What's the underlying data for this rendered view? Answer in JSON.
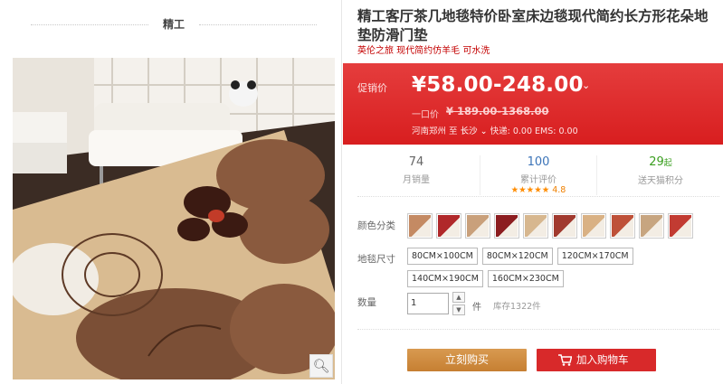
{
  "gallery": {
    "tab_label": "精工",
    "zoom_icon": "magnifier-icon"
  },
  "product": {
    "title": "精工客厅茶几地毯特价卧室床边毯现代简约长方形花朵地垫防滑门垫",
    "subtitle": "英伦之旅 现代简约仿羊毛 可水洗"
  },
  "price": {
    "promo_label": "促销价",
    "value": "¥58.00-248.00",
    "original_label": "一口价",
    "original_value": "¥ 189.00-1368.00",
    "ship_from": "河南郑州",
    "to_word": "至",
    "ship_to": "长沙",
    "shipping": "快递: 0.00  EMS: 0.00"
  },
  "stats": {
    "monthly_sales": {
      "value": "74",
      "label": "月销量"
    },
    "reviews": {
      "value": "100",
      "label": "累计评价",
      "stars": "★★★★★",
      "score": "4.8"
    },
    "points": {
      "value": "29",
      "unit": "起",
      "label": "送天猫积分"
    }
  },
  "options": {
    "color_label": "颜色分类",
    "swatch_colors": [
      "#c48a63",
      "#b0282a",
      "#c9a07b",
      "#8c1d20",
      "#d7b78f",
      "#a13a2f",
      "#d9b184",
      "#be5139",
      "#c7a580",
      "#c23b32"
    ],
    "size_label": "地毯尺寸",
    "sizes": [
      "80CM×100CM",
      "80CM×120CM",
      "120CM×170CM",
      "140CM×190CM",
      "160CM×230CM"
    ],
    "qty_label": "数量",
    "qty_value": "1",
    "qty_unit": "件",
    "stock": "库存1322件"
  },
  "actions": {
    "buy_now": "立刻购买",
    "add_cart": "加入购物车"
  },
  "colors": {
    "price_bg": "#e02f30",
    "buy_now_bg": "#cf8a3d",
    "add_cart_bg": "#d8292a"
  }
}
